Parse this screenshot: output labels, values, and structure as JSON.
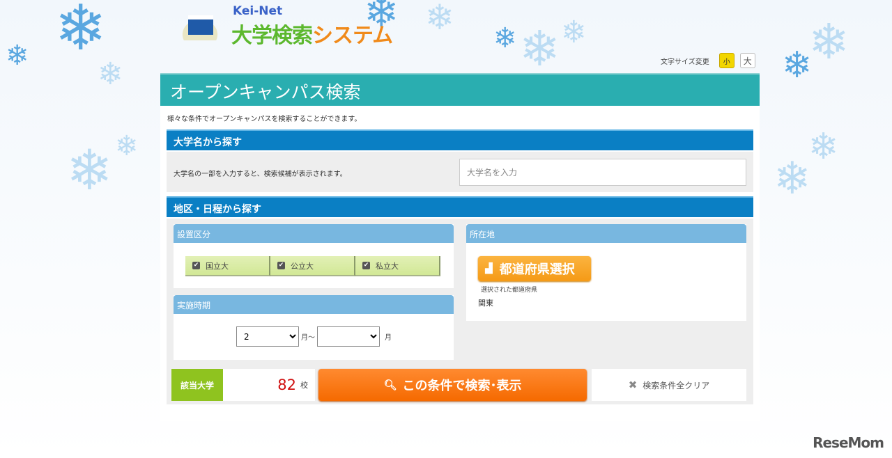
{
  "logo": {
    "brand": "Kei-Net",
    "title_green": "大学検索",
    "title_orange": "システム"
  },
  "font_size": {
    "label": "文字サイズ変更",
    "small": "小",
    "large": "大"
  },
  "page": {
    "title": "オープンキャンパス検索",
    "description": "様々な条件でオープンキャンパスを検索することができます。"
  },
  "by_name": {
    "heading": "大学名から探す",
    "hint": "大学名の一部を入力すると、検索候補が表示されます。",
    "placeholder": "大学名を入力",
    "value": ""
  },
  "by_area": {
    "heading": "地区・日程から探す",
    "type": {
      "heading": "設置区分",
      "options": [
        {
          "label": "国立大",
          "checked": true
        },
        {
          "label": "公立大",
          "checked": true
        },
        {
          "label": "私立大",
          "checked": true
        }
      ]
    },
    "period": {
      "heading": "実施時期",
      "from": "2",
      "to": "",
      "sep": "月〜",
      "unit": "月"
    },
    "location": {
      "heading": "所在地",
      "button": "都道府県選択",
      "selected_label": "選択された都道府県",
      "selected": "関東"
    }
  },
  "result": {
    "label": "該当大学",
    "count": "82",
    "unit": "校",
    "search_button": "この条件で検索･表示",
    "clear_button": "検索条件全クリア"
  },
  "watermark": "ReseMom"
}
